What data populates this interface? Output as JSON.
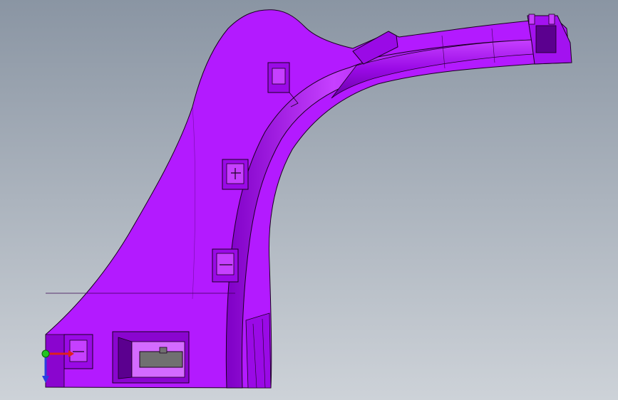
{
  "viewport": {
    "background_top": "#8a95a3",
    "background_bottom": "#cdd2d8"
  },
  "part": {
    "fill": "#b31aff",
    "fill_light": "#cc4dff",
    "fill_dark": "#7f00c6",
    "fill_deep": "#5b008f",
    "edge": "#1a001f"
  },
  "triad": {
    "x_color": "#e0201c",
    "y_color": "#22c422",
    "z_color": "#2a3fe0"
  }
}
